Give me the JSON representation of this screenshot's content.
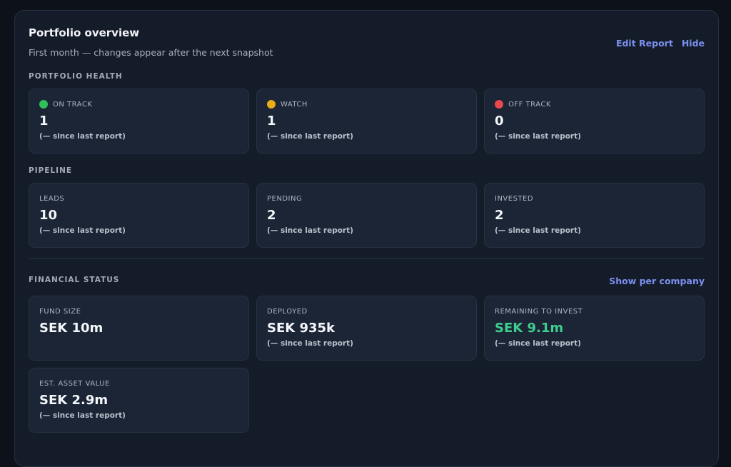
{
  "header": {
    "title": "Portfolio overview",
    "subtitle": "First month — changes appear after the next snapshot",
    "edit_label": "Edit Report",
    "hide_label": "Hide"
  },
  "health": {
    "label": "PORTFOLIO HEALTH",
    "cards": [
      {
        "label": "ON TRACK",
        "value": "1",
        "delta": "(— since last report)",
        "color": "#2fbf5b"
      },
      {
        "label": "WATCH",
        "value": "1",
        "delta": "(— since last report)",
        "color": "#e9ac1a"
      },
      {
        "label": "OFF TRACK",
        "value": "0",
        "delta": "(— since last report)",
        "color": "#e5484d"
      }
    ]
  },
  "pipeline": {
    "label": "PIPELINE",
    "cards": [
      {
        "label": "LEADS",
        "value": "10",
        "delta": "(— since last report)"
      },
      {
        "label": "PENDING",
        "value": "2",
        "delta": "(— since last report)"
      },
      {
        "label": "INVESTED",
        "value": "2",
        "delta": "(— since last report)"
      }
    ]
  },
  "financial": {
    "label": "FINANCIAL STATUS",
    "show_per_label": "Show per company",
    "cards": [
      {
        "label": "FUND SIZE",
        "value": "SEK 10m"
      },
      {
        "label": "DEPLOYED",
        "value": "SEK 935k",
        "delta": "(— since last report)"
      },
      {
        "label": "REMAINING TO INVEST",
        "value": "SEK 9.1m",
        "delta": "(— since last report)",
        "value_color": "#3ecf8e"
      },
      {
        "label": "EST. ASSET VALUE",
        "value": "SEK 2.9m",
        "delta": "(— since last report)"
      }
    ]
  }
}
